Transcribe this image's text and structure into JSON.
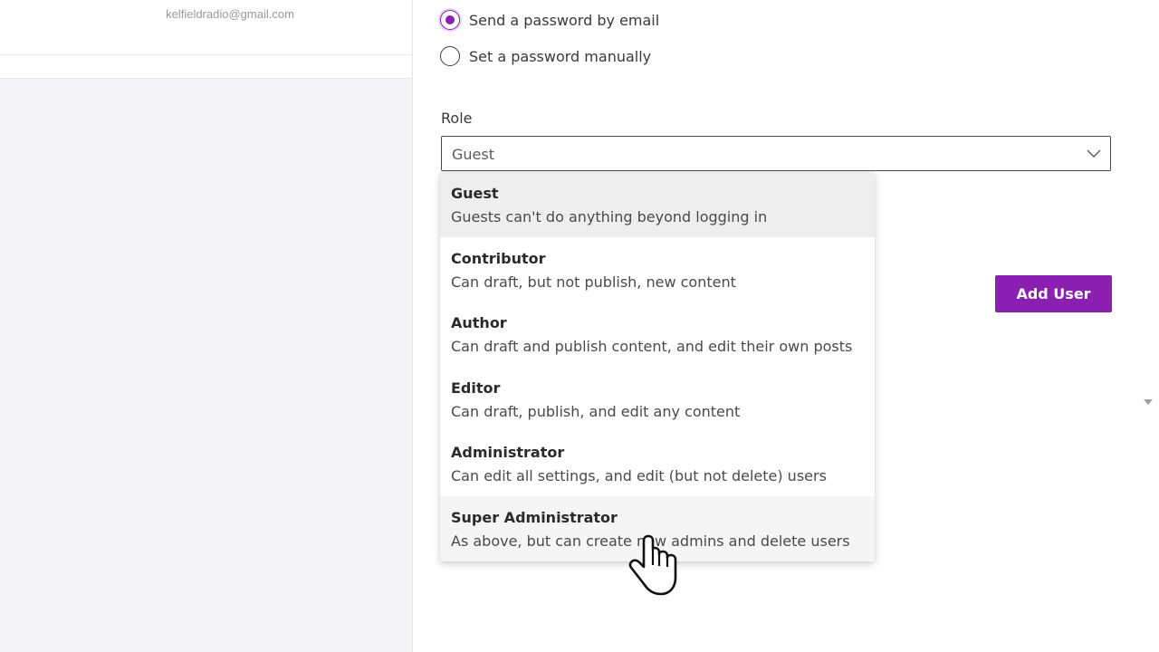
{
  "left": {
    "email": "kelfieldradio@gmail.com"
  },
  "password": {
    "options": [
      {
        "label": "Send a password by email",
        "checked": true
      },
      {
        "label": "Set a password manually",
        "checked": false
      }
    ]
  },
  "role": {
    "label": "Role",
    "selected": "Guest",
    "options": [
      {
        "title": "Guest",
        "description": "Guests can't do anything beyond logging in"
      },
      {
        "title": "Contributor",
        "description": "Can draft, but not publish, new content"
      },
      {
        "title": "Author",
        "description": "Can draft and publish content, and edit their own posts"
      },
      {
        "title": "Editor",
        "description": "Can draft, publish, and edit any content"
      },
      {
        "title": "Administrator",
        "description": "Can edit all settings, and edit (but not delete) users"
      },
      {
        "title": "Super Administrator",
        "description": "As above, but can create new admins and delete users"
      }
    ]
  },
  "actions": {
    "add_user": "Add User"
  },
  "colors": {
    "accent": "#8a1fb2"
  },
  "icons": {
    "select": "chevron-down-icon",
    "cursor": "hand-pointer-icon",
    "scroll": "scroll-down-arrow-icon"
  }
}
